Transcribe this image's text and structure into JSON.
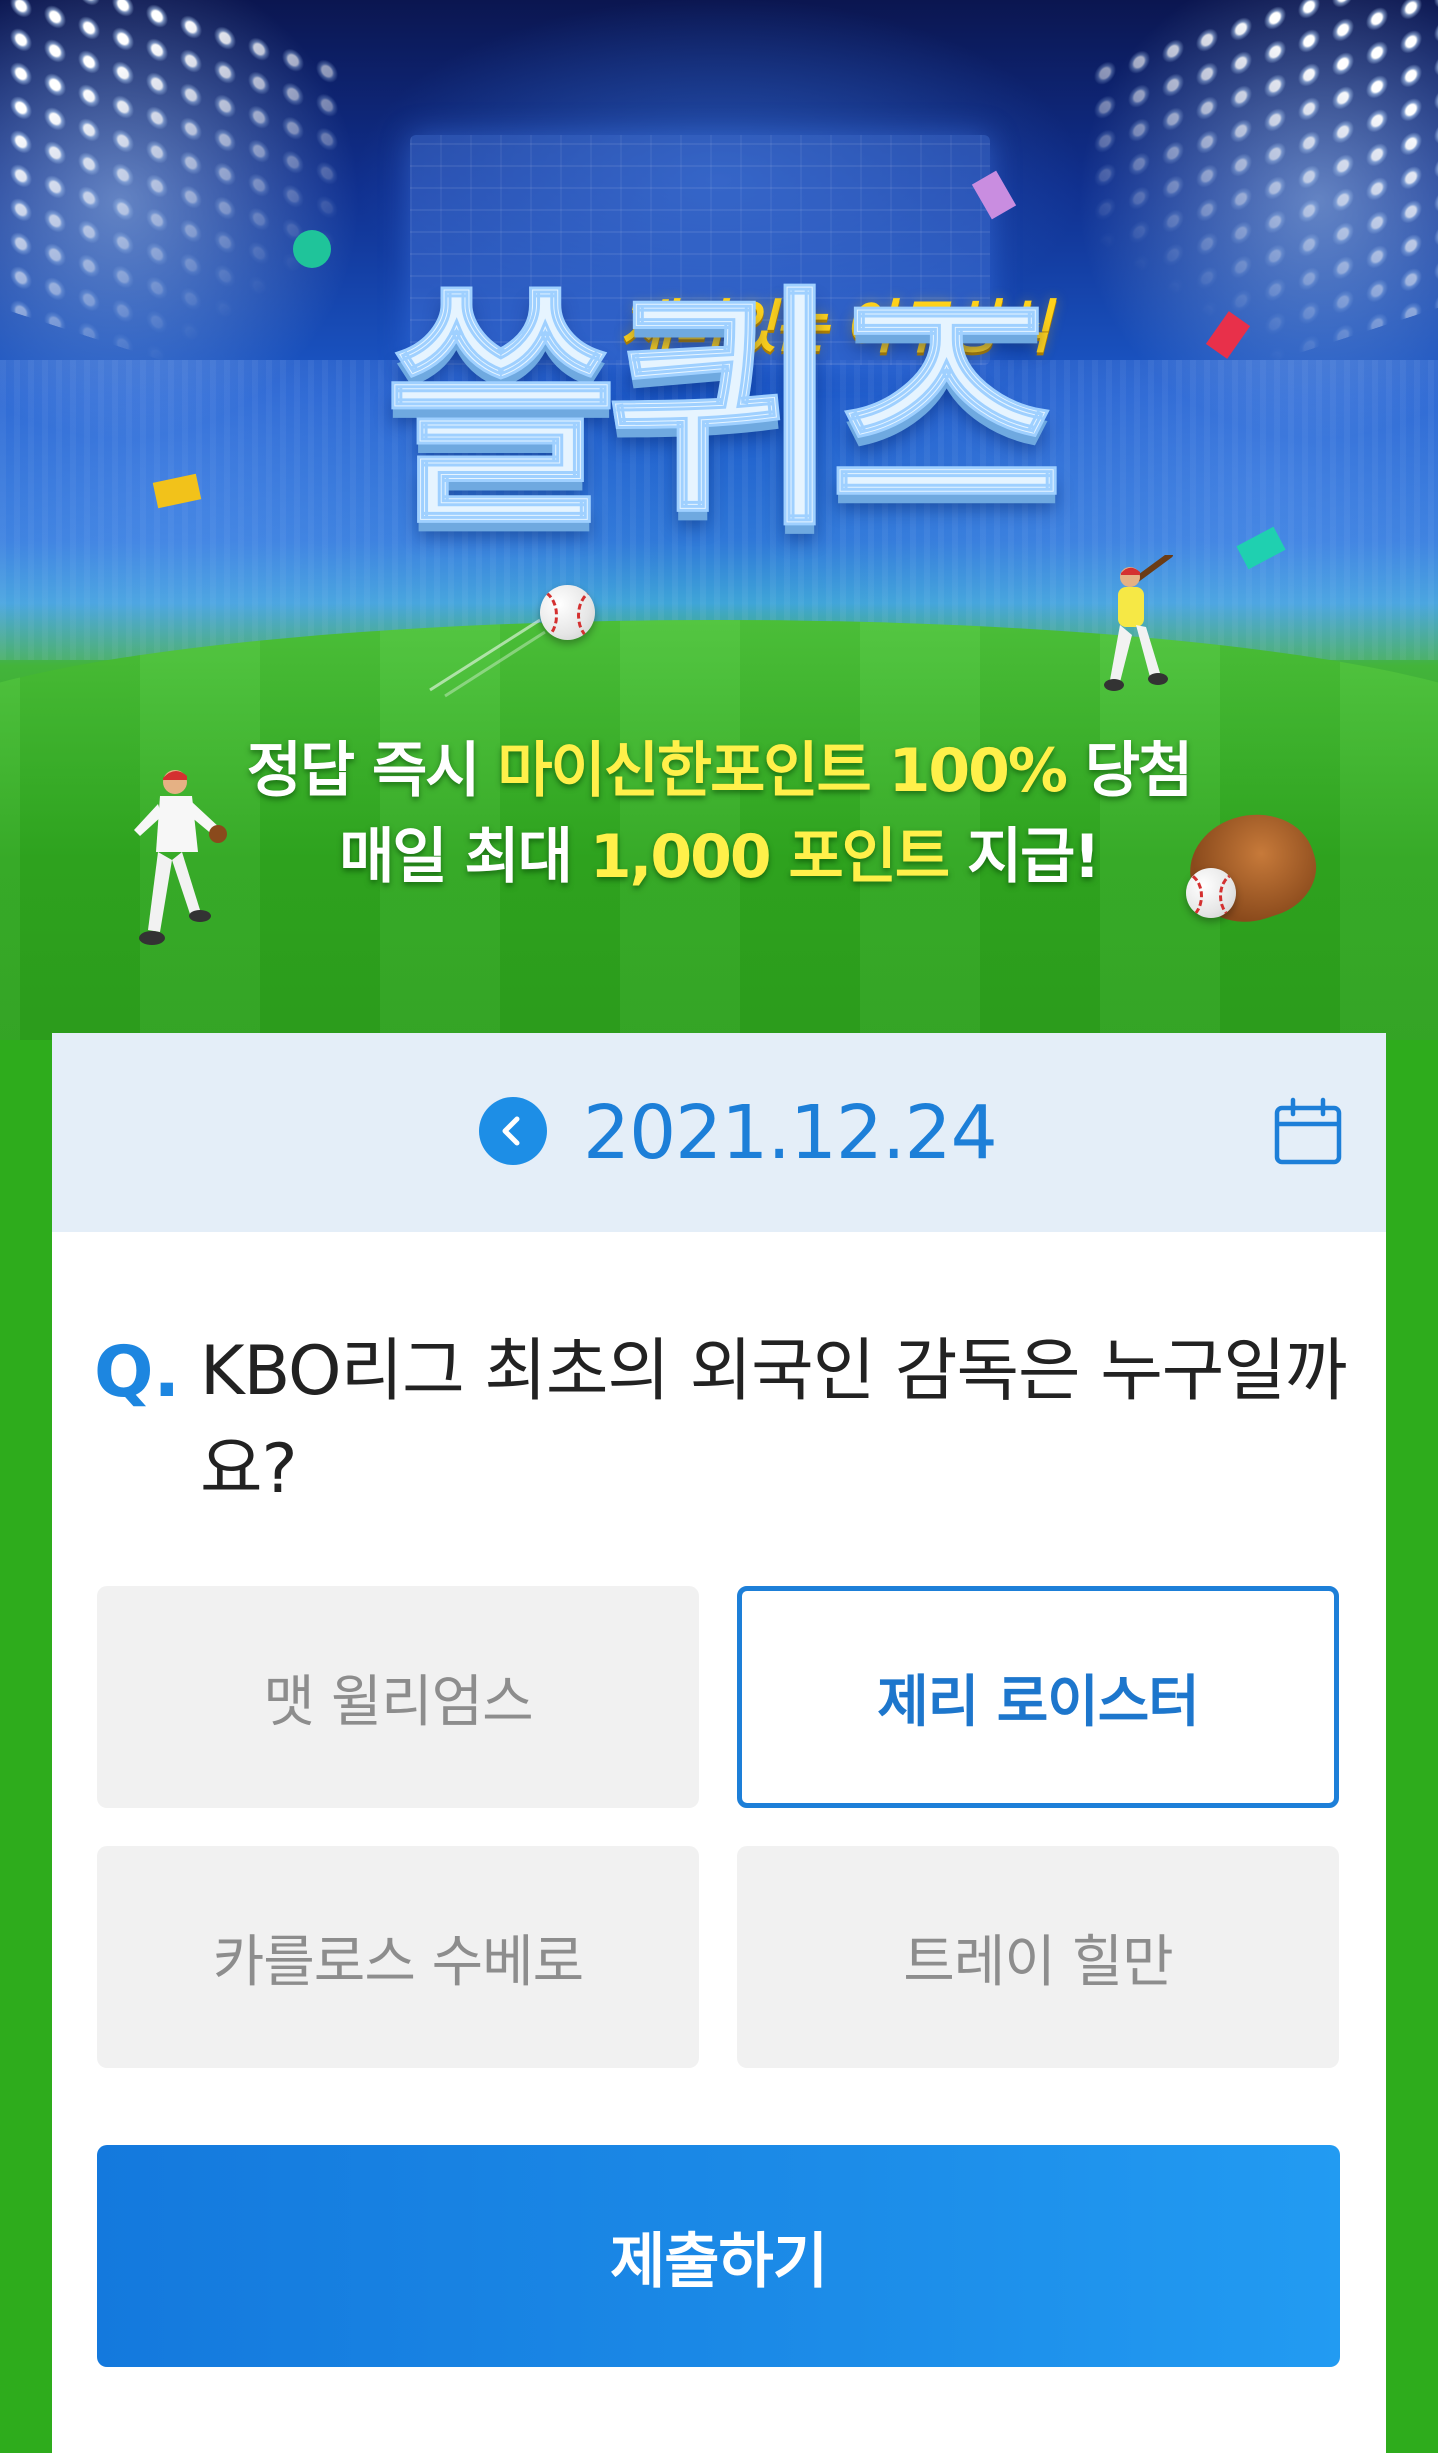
{
  "hero": {
    "tagline": "재미있는 야구상식",
    "title": "쓸퀴즈",
    "line1_a": "정답 즉시 ",
    "line1_highlight": "마이신한포인트 100%",
    "line1_b": " 당첨",
    "line2_a": "매일 최대 ",
    "line2_highlight": "1,000 포인트",
    "line2_b": " 지급!",
    "colors": {
      "highlight": "#fff04a",
      "tagline": "#ffd21a",
      "field_green": "#2eac1c",
      "sky_blue": "#1b58c8"
    }
  },
  "date_bar": {
    "date": "2021.12.24",
    "prev_icon": "chevron-left-icon",
    "calendar_icon": "calendar-icon"
  },
  "question": {
    "prefix": "Q.",
    "text": "KBO리그 최초의 외국인 감독은 누구일까요?"
  },
  "options": [
    {
      "label": "맷 윌리엄스",
      "selected": false
    },
    {
      "label": "제리 로이스터",
      "selected": true
    },
    {
      "label": "카를로스 수베로",
      "selected": false
    },
    {
      "label": "트레이 힐만",
      "selected": false
    }
  ],
  "submit": {
    "label": "제출하기"
  },
  "colors": {
    "accent": "#1d7fd8",
    "date_bar_bg": "#e4eef8",
    "option_bg": "#f1f1f1",
    "option_text": "#8d8d8d",
    "question_text": "#222222"
  }
}
